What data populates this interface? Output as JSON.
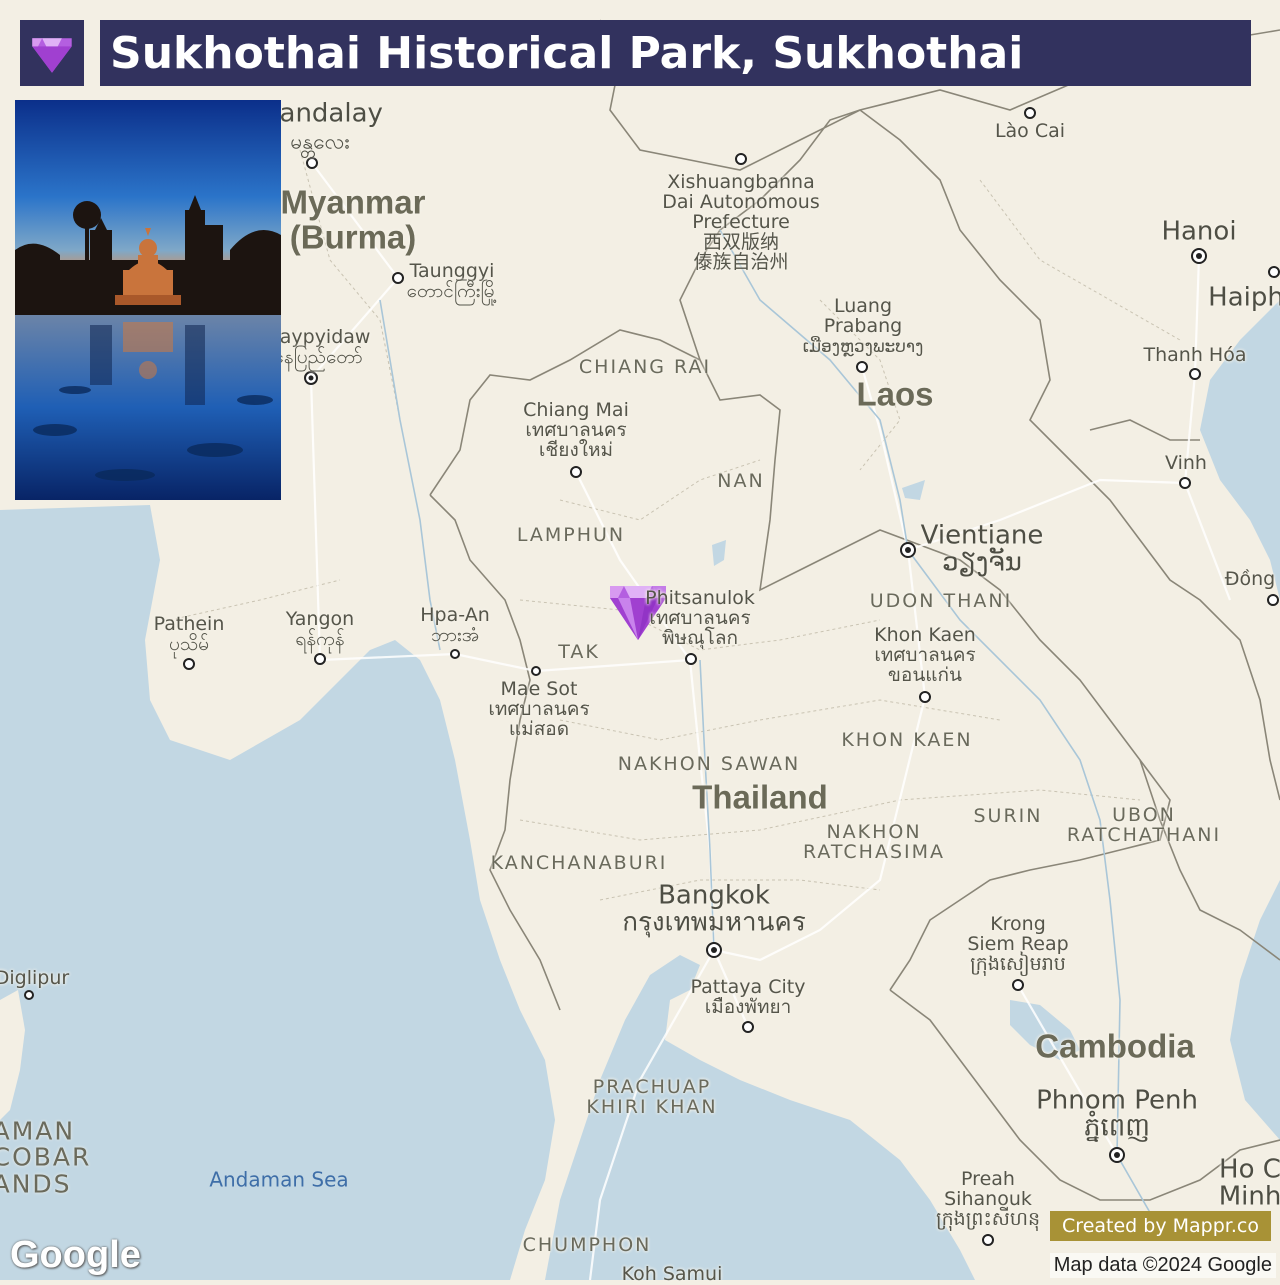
{
  "header": {
    "title": "Sukhothai Historical Park, Sukhothai",
    "icon": "gem-icon"
  },
  "marker": {
    "icon": "gem-icon",
    "color": "#b45fe0",
    "name": "Sukhothai Historical Park"
  },
  "photo": {
    "subject": "Buddha statue among temple ruins reflected in water at dusk"
  },
  "labels": {
    "countries": {
      "myanmar_1": "Myanmar",
      "myanmar_2": "(Burma)",
      "laos": "Laos",
      "thailand": "Thailand",
      "cambodia": "Cambodia"
    },
    "cities": {
      "mandalay": "Mandalay",
      "mandalay_local": "မန္တလေး",
      "taunggyi": "Taunggyi",
      "taunggyi_local": "တောင်ကြီးမြို့",
      "naypyidaw": "Naypyidaw",
      "naypyidaw_local": "နေပြည်တော်",
      "pathein": "Pathein",
      "pathein_local": "ပုသိမ်",
      "yangon": "Yangon",
      "yangon_local": "ရန်ကုန်",
      "hpa_an": "Hpa-An",
      "hpa_an_local": "ဘားအံ",
      "xishuangbanna_1": "Xishuangbanna",
      "xishuangbanna_2": "Dai Autonomous",
      "xishuangbanna_3": "Prefecture",
      "xishuangbanna_4": "西双版纳",
      "xishuangbanna_5": "傣族自治州",
      "lao_cai": "Lào Cai",
      "hanoi": "Hanoi",
      "haiphong": "Haiph",
      "thanh_hoa": "Thanh Hóa",
      "vinh": "Vinh",
      "dong_hoi": "Đồng",
      "luang_prabang_1": "Luang",
      "luang_prabang_2": "Prabang",
      "luang_prabang_3": "ເມືອງຫຼວງພະບາງ",
      "chiang_mai_1": "Chiang Mai",
      "chiang_mai_2": "เทศบาลนคร",
      "chiang_mai_3": "เชียงใหม่",
      "vientiane": "Vientiane",
      "vientiane_local": "ວຽງຈັນ",
      "phitsanulok_1": "Phitsanulok",
      "phitsanulok_2": "เทศบาลนคร",
      "phitsanulok_3": "พิษณุโลก",
      "khon_kaen_1": "Khon Kaen",
      "khon_kaen_2": "เทศบาลนคร",
      "khon_kaen_3": "ขอนแก่น",
      "mae_sot_1": "Mae Sot",
      "mae_sot_2": "เทศบาลนคร",
      "mae_sot_3": "แม่สอด",
      "bangkok": "Bangkok",
      "bangkok_local": "กรุงเทพมหานคร",
      "pattaya_1": "Pattaya City",
      "pattaya_2": "เมืองพัทยา",
      "siem_reap_1": "Krong",
      "siem_reap_2": "Siem Reap",
      "siem_reap_3": "ក្រុងសៀមរាប",
      "phnom_penh": "Phnom Penh",
      "phnom_penh_local": "ភ្នំពេញ",
      "sihanouk_1": "Preah",
      "sihanouk_2": "Sihanouk",
      "sihanouk_3": "ក្រុងព្រះសីហនុ",
      "ho_chi_minh_1": "Ho C",
      "ho_chi_minh_2": "Minh",
      "diglipur": "Diglipur",
      "koh_samui": "Koh Samui"
    },
    "provinces": {
      "chiang_rai": "CHIANG RAI",
      "nan": "NAN",
      "lamphun": "LAMPHUN",
      "tak": "TAK",
      "udon_thani": "UDON THANI",
      "khon_kaen": "KHON KAEN",
      "nakhon_sawan": "NAKHON SAWAN",
      "surin": "SURIN",
      "ubon_1": "UBON",
      "ubon_2": "RATCHATHANI",
      "nakhon_r_1": "NAKHON",
      "nakhon_r_2": "RATCHASIMA",
      "kanchanaburi": "KANCHANABURI",
      "prachuap_1": "PRACHUAP",
      "prachuap_2": "KHIRI KHAN",
      "chumphon": "CHUMPHON",
      "andaman_1": "AMAN",
      "andaman_2": "COBAR",
      "andaman_3": "ANDS"
    },
    "seas": {
      "andaman_sea": "Andaman Sea"
    }
  },
  "footer": {
    "credit": "Created by Mappr.co",
    "attribution": "Map data ©2024 Google",
    "logo": "Google"
  },
  "colors": {
    "land": "#f3efe4",
    "water": "#c2d7e3",
    "title_bg": "#32325e",
    "credit_bg": "#a89236"
  }
}
